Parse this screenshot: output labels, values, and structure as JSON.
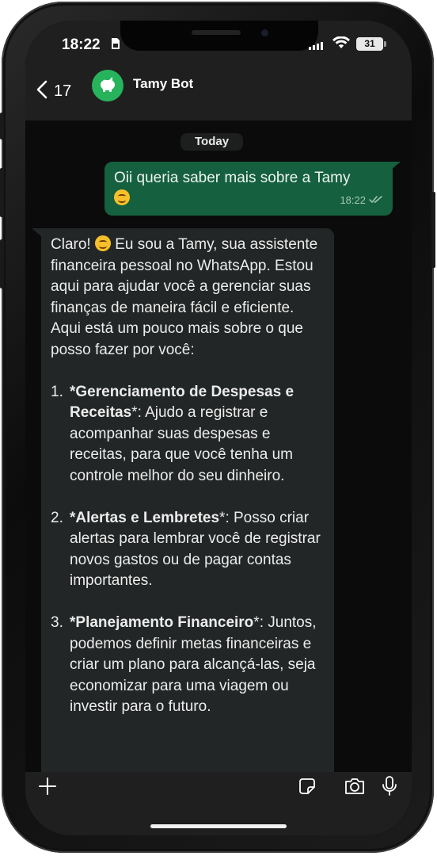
{
  "status_bar": {
    "time": "18:22",
    "battery": "31"
  },
  "header": {
    "back_count": "17",
    "contact_name": "Tamy Bot"
  },
  "chat": {
    "date_label": "Today",
    "outgoing": {
      "text": "Oii queria saber mais sobre a Tamy",
      "time": "18:22"
    },
    "incoming": {
      "intro_prefix": "Claro!",
      "intro_rest": " Eu sou a Tamy, sua assistente financeira pessoal no WhatsApp. Estou aqui para ajudar você a gerenciar suas finanças de maneira fácil e eficiente. Aqui está um pouco mais sobre o que posso fazer por você:",
      "items": [
        {
          "number": "1.",
          "title": "*Gerenciamento de Despesas e Receitas",
          "rest": "*: Ajudo a registrar e acompanhar suas despesas e receitas, para que você tenha um controle melhor do seu dinheiro."
        },
        {
          "number": "2.",
          "title": "*Alertas e Lembretes",
          "rest": "*: Posso criar alertas para lembrar você de registrar novos gastos ou de pagar contas importantes."
        },
        {
          "number": "3.",
          "title": "*Planejamento Financeiro",
          "rest": "*: Juntos, podemos definir metas financeiras e criar um plano para alcançá-las, seja economizar para uma viagem ou investir para o futuro."
        }
      ]
    }
  },
  "colors": {
    "outgoing_bubble": "#15603e",
    "incoming_bubble": "#232626",
    "avatar_bg": "#27b35b",
    "chat_background": "#0b0b0b",
    "bar_background": "#1f1f1f"
  },
  "icons": {
    "back": "chevron-left-icon",
    "avatar": "piggy-bank-icon",
    "plus": "plus-icon",
    "sticker": "sticker-icon",
    "camera": "camera-icon",
    "mic": "microphone-icon",
    "read_receipt": "double-check-icon"
  }
}
